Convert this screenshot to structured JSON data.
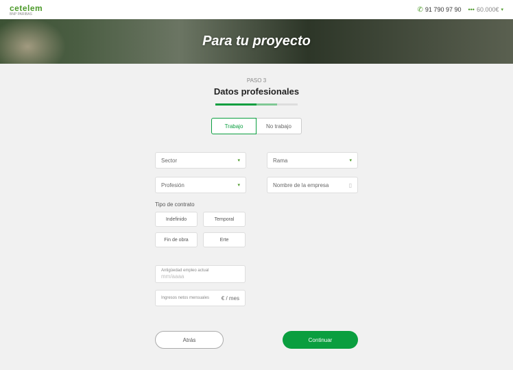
{
  "header": {
    "logo_text": "cetelem",
    "logo_sub": "BNP PARIBAS",
    "phone": "91 790 97 90",
    "amount": "60.000€"
  },
  "hero": {
    "title": "Para tu proyecto"
  },
  "step": {
    "label": "PASO 3",
    "title": "Datos profesionales"
  },
  "tabs": {
    "work": "Trabajo",
    "nowork": "No trabajo"
  },
  "fields": {
    "sector": "Sector",
    "rama": "Rama",
    "profesion": "Profesión",
    "empresa_placeholder": "Nombre de la empresa"
  },
  "contract": {
    "label": "Tipo de contrato",
    "indefinido": "Indefinido",
    "temporal": "Temporal",
    "fin_obra": "Fin de obra",
    "erte": "Erte"
  },
  "seniority": {
    "label": "Antigüedad empleo actual",
    "placeholder": "mm/aaaa"
  },
  "income": {
    "label": "Ingresos netos mensuales",
    "unit": "€ / mes"
  },
  "actions": {
    "back": "Atrás",
    "continue": "Continuar"
  }
}
